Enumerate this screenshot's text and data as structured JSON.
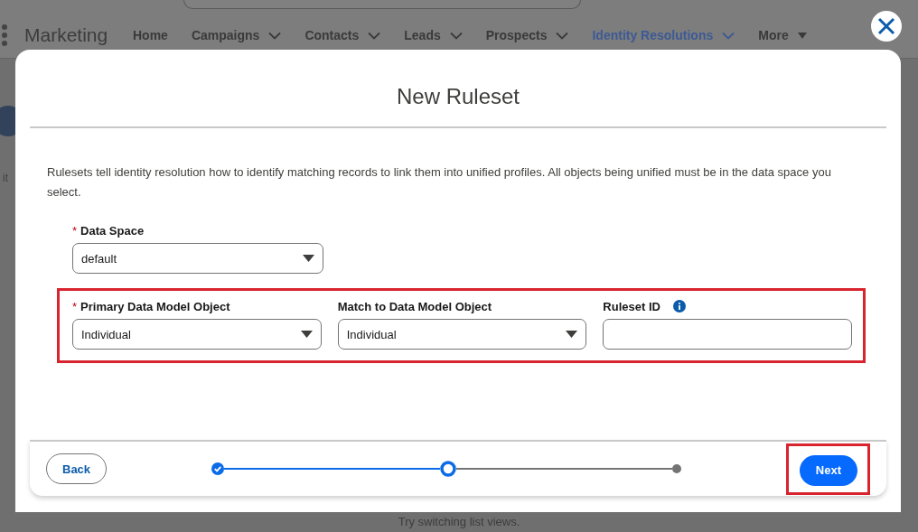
{
  "app": {
    "name": "Marketing",
    "nav": [
      {
        "label": "Home",
        "has_menu": false,
        "selected": false
      },
      {
        "label": "Campaigns",
        "has_menu": true,
        "selected": false
      },
      {
        "label": "Contacts",
        "has_menu": true,
        "selected": false
      },
      {
        "label": "Leads",
        "has_menu": true,
        "selected": false
      },
      {
        "label": "Prospects",
        "has_menu": true,
        "selected": false
      },
      {
        "label": "Identity Resolutions",
        "has_menu": true,
        "selected": true
      }
    ],
    "more": "More"
  },
  "background": {
    "count_fragment": "it",
    "empty_hint": "Try switching list views."
  },
  "modal": {
    "title": "New Ruleset",
    "description": "Rulesets tell identity resolution how to identify matching records to link them into unified profiles. All objects being unified must be in the data space you select.",
    "field_groups": [
      {
        "highlighted": false,
        "fields": [
          {
            "label": "Data Space",
            "required_mark": "*",
            "kind": "select",
            "value": "default",
            "info": false
          }
        ]
      },
      {
        "highlighted": true,
        "fields": [
          {
            "label": "Primary Data Model Object",
            "required_mark": "*",
            "kind": "select",
            "value": "Individual",
            "info": false
          },
          {
            "label": "Match to Data Model Object",
            "kind": "select",
            "value": "Individual",
            "info": false
          },
          {
            "label": "Ruleset ID",
            "kind": "text",
            "info": true
          }
        ]
      }
    ],
    "footer": {
      "back": "Back",
      "steps": [
        {
          "kind": "complete"
        },
        {
          "kind": "current"
        },
        {
          "kind": "upcoming"
        }
      ],
      "next": {
        "label": "Next",
        "highlighted": true
      }
    }
  }
}
